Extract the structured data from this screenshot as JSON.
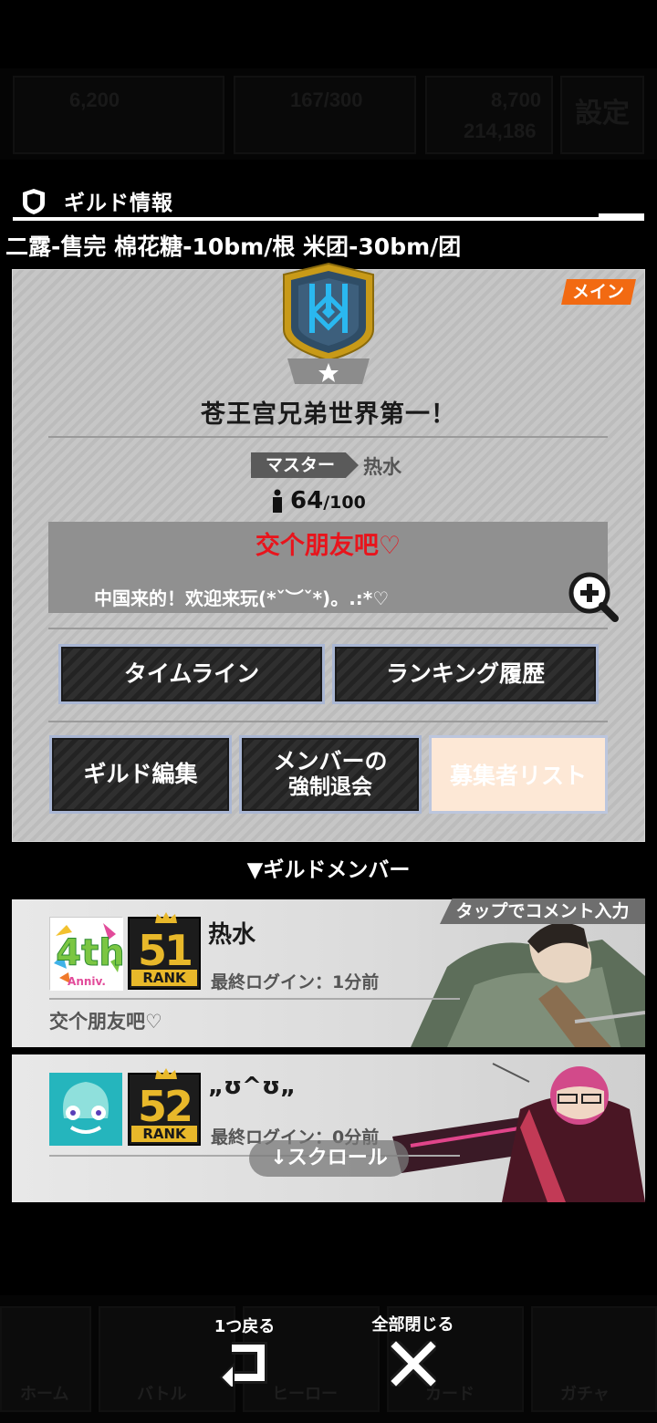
{
  "background": {
    "resource_1": "6,200",
    "resource_2": "167/300",
    "resource_3": "8,700",
    "resource_4": "214,186",
    "settings_label": "設定",
    "nav": [
      "ホーム",
      "バトル",
      "ヒーロー",
      "カード",
      "ガチャ"
    ]
  },
  "panel": {
    "title": "ギルド情報",
    "marquee": "二露-售完 棉花糖-10bm/根 米团-30bm/团",
    "main_tag": "メイン",
    "guild_name": "苍王宫兄弟世界第一！",
    "master_label": "マスター",
    "master_name": "热水",
    "member_count": "64",
    "member_max": "/100",
    "comment_title": "交个朋友吧♡",
    "comment_body": "中国来的！欢迎来玩(*ˇ︶ˇ*)。.:*♡",
    "buttons": {
      "timeline": "タイムライン",
      "ranking_history": "ランキング履歴",
      "guild_edit": "ギルド編集",
      "kick_member_line1": "メンバーの",
      "kick_member_line2": "強制退会",
      "recruit_list": "募集者リスト"
    }
  },
  "members_section": {
    "label": "▼ギルドメンバー",
    "tap_hint": "タップでコメント入力",
    "members": [
      {
        "name": "热水",
        "rank": "51",
        "rank_label": "RANK",
        "login": "最終ログイン：1分前",
        "comment": "交个朋友吧♡",
        "avatar_text_1": "4th",
        "avatar_text_2": "Anniv."
      },
      {
        "name": "„ʊ^ʊ„",
        "rank": "52",
        "rank_label": "RANK",
        "login": "最終ログイン：0分前",
        "comment": ""
      }
    ],
    "scroll_label": "↓スクロール"
  },
  "footer": {
    "back_label": "1つ戻る",
    "close_all_label": "全部閉じる"
  },
  "colors": {
    "accent_orange": "#f26a12",
    "comment_red": "#e8141c",
    "rank_gold": "#e8b82a",
    "button_border": "#a9b6d3"
  }
}
